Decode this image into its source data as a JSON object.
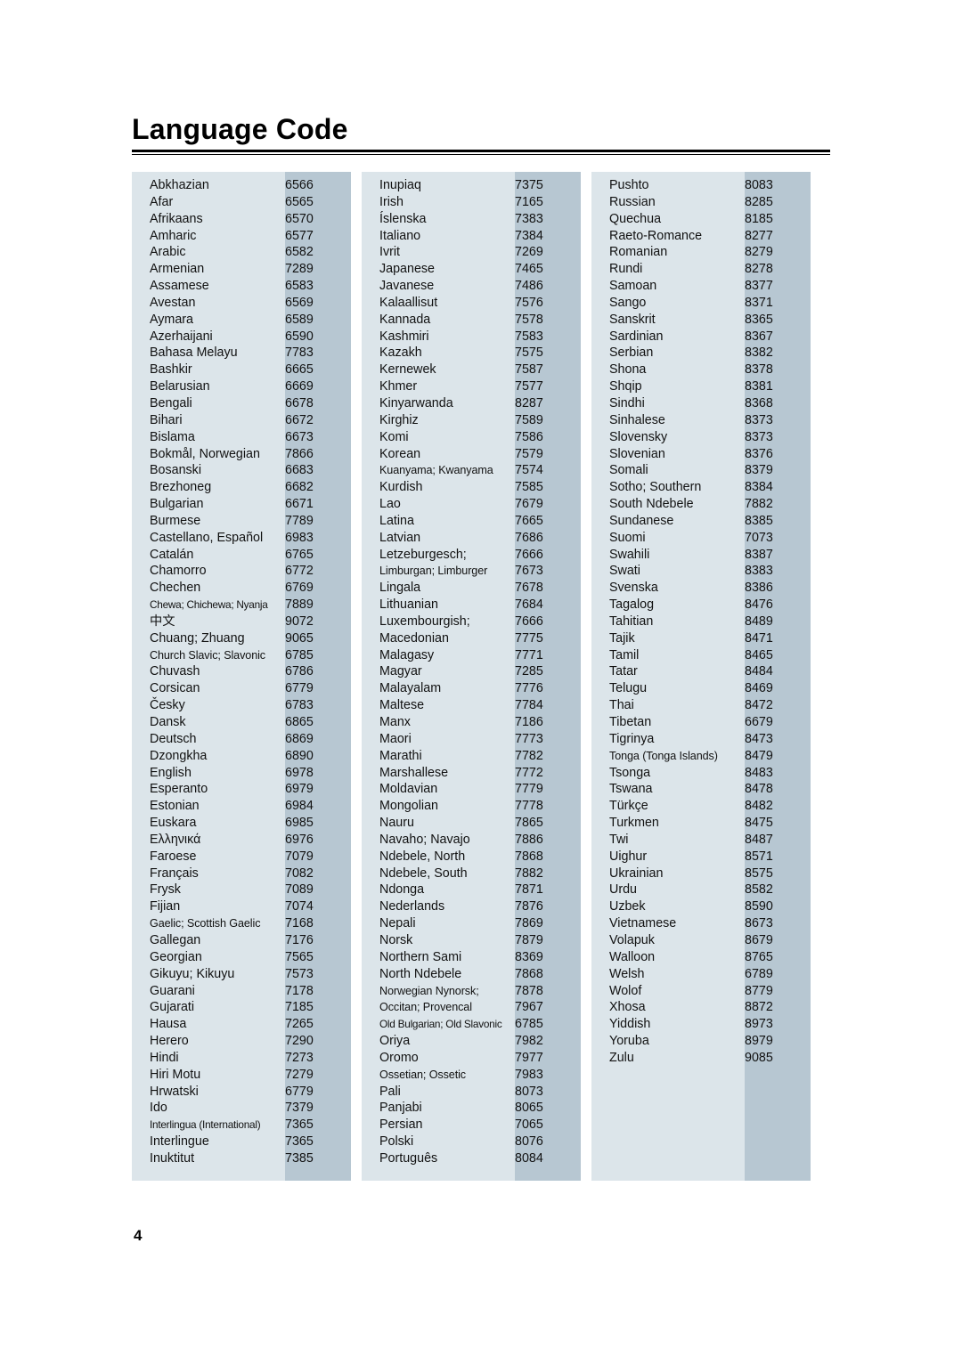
{
  "document": {
    "title": "Language Code",
    "page_number": "4"
  },
  "colors": {
    "row_light": "#dce5ea",
    "code_band": "#b7c7d2",
    "text": "#111111",
    "rule": "#000000"
  },
  "columns": [
    {
      "id": "column-1",
      "entries": [
        {
          "language": "Abkhazian",
          "code": "6566"
        },
        {
          "language": "Afar",
          "code": "6565"
        },
        {
          "language": "Afrikaans",
          "code": "6570"
        },
        {
          "language": "Amharic",
          "code": "6577"
        },
        {
          "language": "Arabic",
          "code": "6582"
        },
        {
          "language": "Armenian",
          "code": "7289"
        },
        {
          "language": "Assamese",
          "code": "6583"
        },
        {
          "language": "Avestan",
          "code": "6569"
        },
        {
          "language": "Aymara",
          "code": "6589"
        },
        {
          "language": "Azerhaijani",
          "code": "6590"
        },
        {
          "language": "Bahasa Melayu",
          "code": "7783"
        },
        {
          "language": "Bashkir",
          "code": "6665"
        },
        {
          "language": "Belarusian",
          "code": "6669"
        },
        {
          "language": "Bengali",
          "code": "6678"
        },
        {
          "language": "Bihari",
          "code": "6672"
        },
        {
          "language": "Bislama",
          "code": "6673"
        },
        {
          "language": "Bokmål, Norwegian",
          "code": "7866"
        },
        {
          "language": "Bosanski",
          "code": "6683"
        },
        {
          "language": "Brezhoneg",
          "code": "6682"
        },
        {
          "language": "Bulgarian",
          "code": "6671"
        },
        {
          "language": "Burmese",
          "code": "7789"
        },
        {
          "language": "Castellano, Español",
          "code": "6983"
        },
        {
          "language": "Catalán",
          "code": "6765"
        },
        {
          "language": "Chamorro",
          "code": "6772"
        },
        {
          "language": "Chechen",
          "code": "6769"
        },
        {
          "language": "Chewa; Chichewa; Nyanja",
          "code": "7889",
          "size": "xsm"
        },
        {
          "language": "中文",
          "code": "9072"
        },
        {
          "language": "Chuang; Zhuang",
          "code": "9065"
        },
        {
          "language": "Church Slavic; Slavonic",
          "code": "6785",
          "size": "sm"
        },
        {
          "language": "Chuvash",
          "code": "6786"
        },
        {
          "language": "Corsican",
          "code": "6779"
        },
        {
          "language": "Česky",
          "code": "6783"
        },
        {
          "language": "Dansk",
          "code": "6865"
        },
        {
          "language": "Deutsch",
          "code": "6869"
        },
        {
          "language": "Dzongkha",
          "code": "6890"
        },
        {
          "language": "English",
          "code": "6978"
        },
        {
          "language": "Esperanto",
          "code": "6979"
        },
        {
          "language": "Estonian",
          "code": "6984"
        },
        {
          "language": "Euskara",
          "code": "6985"
        },
        {
          "language": "Ελληνικά",
          "code": "6976"
        },
        {
          "language": "Faroese",
          "code": "7079"
        },
        {
          "language": "Français",
          "code": "7082"
        },
        {
          "language": "Frysk",
          "code": "7089"
        },
        {
          "language": "Fijian",
          "code": "7074"
        },
        {
          "language": "Gaelic; Scottish Gaelic",
          "code": "7168",
          "size": "sm"
        },
        {
          "language": "Gallegan",
          "code": "7176"
        },
        {
          "language": "Georgian",
          "code": "7565"
        },
        {
          "language": "Gikuyu; Kikuyu",
          "code": "7573"
        },
        {
          "language": "Guarani",
          "code": "7178"
        },
        {
          "language": "Gujarati",
          "code": "7185"
        },
        {
          "language": "Hausa",
          "code": "7265"
        },
        {
          "language": "Herero",
          "code": "7290"
        },
        {
          "language": "Hindi",
          "code": "7273"
        },
        {
          "language": "Hiri Motu",
          "code": "7279"
        },
        {
          "language": "Hrwatski",
          "code": "6779"
        },
        {
          "language": "Ido",
          "code": "7379"
        },
        {
          "language": "Interlingua (International)",
          "code": "7365",
          "size": "xsm"
        },
        {
          "language": "Interlingue",
          "code": "7365"
        },
        {
          "language": "Inuktitut",
          "code": "7385"
        }
      ]
    },
    {
      "id": "column-2",
      "entries": [
        {
          "language": "Inupiaq",
          "code": "7375"
        },
        {
          "language": "Irish",
          "code": "7165"
        },
        {
          "language": "Íslenska",
          "code": "7383"
        },
        {
          "language": "Italiano",
          "code": "7384"
        },
        {
          "language": "Ivrit",
          "code": "7269"
        },
        {
          "language": "Japanese",
          "code": "7465"
        },
        {
          "language": "Javanese",
          "code": "7486"
        },
        {
          "language": "Kalaallisut",
          "code": "7576"
        },
        {
          "language": "Kannada",
          "code": "7578"
        },
        {
          "language": "Kashmiri",
          "code": "7583"
        },
        {
          "language": "Kazakh",
          "code": "7575"
        },
        {
          "language": "Kernewek",
          "code": "7587"
        },
        {
          "language": "Khmer",
          "code": "7577"
        },
        {
          "language": "Kinyarwanda",
          "code": "8287"
        },
        {
          "language": "Kirghiz",
          "code": "7589"
        },
        {
          "language": "Komi",
          "code": "7586"
        },
        {
          "language": "Korean",
          "code": "7579"
        },
        {
          "language": "Kuanyama; Kwanyama",
          "code": "7574",
          "size": "sm"
        },
        {
          "language": "Kurdish",
          "code": "7585"
        },
        {
          "language": "Lao",
          "code": "7679"
        },
        {
          "language": "Latina",
          "code": "7665"
        },
        {
          "language": "Latvian",
          "code": "7686"
        },
        {
          "language": "Letzeburgesch;",
          "code": "7666"
        },
        {
          "language": "Limburgan; Limburger",
          "code": "7673",
          "size": "sm"
        },
        {
          "language": "Lingala",
          "code": "7678"
        },
        {
          "language": "Lithuanian",
          "code": "7684"
        },
        {
          "language": "Luxembourgish;",
          "code": "7666"
        },
        {
          "language": "Macedonian",
          "code": "7775"
        },
        {
          "language": "Malagasy",
          "code": "7771"
        },
        {
          "language": "Magyar",
          "code": "7285"
        },
        {
          "language": "Malayalam",
          "code": "7776"
        },
        {
          "language": "Maltese",
          "code": "7784"
        },
        {
          "language": "Manx",
          "code": "7186"
        },
        {
          "language": "Maori",
          "code": "7773"
        },
        {
          "language": "Marathi",
          "code": "7782"
        },
        {
          "language": "Marshallese",
          "code": "7772"
        },
        {
          "language": "Moldavian",
          "code": "7779"
        },
        {
          "language": "Mongolian",
          "code": "7778"
        },
        {
          "language": "Nauru",
          "code": "7865"
        },
        {
          "language": "Navaho; Navajo",
          "code": "7886"
        },
        {
          "language": "Ndebele, North",
          "code": "7868"
        },
        {
          "language": "Ndebele, South",
          "code": "7882"
        },
        {
          "language": "Ndonga",
          "code": "7871"
        },
        {
          "language": "Nederlands",
          "code": "7876"
        },
        {
          "language": "Nepali",
          "code": "7869"
        },
        {
          "language": "Norsk",
          "code": "7879"
        },
        {
          "language": "Northern Sami",
          "code": "8369"
        },
        {
          "language": "North Ndebele",
          "code": "7868"
        },
        {
          "language": "Norwegian Nynorsk;",
          "code": "7878",
          "size": "sm"
        },
        {
          "language": "Occitan; Provencal",
          "code": "7967",
          "size": "sm"
        },
        {
          "language": "Old Bulgarian; Old Slavonic",
          "code": "6785",
          "size": "xsm"
        },
        {
          "language": "Oriya",
          "code": "7982"
        },
        {
          "language": "Oromo",
          "code": "7977"
        },
        {
          "language": "Ossetian; Ossetic",
          "code": "7983",
          "size": "sm"
        },
        {
          "language": "Pali",
          "code": "8073"
        },
        {
          "language": "Panjabi",
          "code": "8065"
        },
        {
          "language": "Persian",
          "code": "7065"
        },
        {
          "language": "Polski",
          "code": "8076"
        },
        {
          "language": "Português",
          "code": "8084"
        }
      ]
    },
    {
      "id": "column-3",
      "entries": [
        {
          "language": "Pushto",
          "code": "8083"
        },
        {
          "language": "Russian",
          "code": "8285"
        },
        {
          "language": "Quechua",
          "code": "8185"
        },
        {
          "language": "Raeto-Romance",
          "code": "8277"
        },
        {
          "language": "Romanian",
          "code": "8279"
        },
        {
          "language": "Rundi",
          "code": "8278"
        },
        {
          "language": "Samoan",
          "code": "8377"
        },
        {
          "language": "Sango",
          "code": "8371"
        },
        {
          "language": "Sanskrit",
          "code": "8365"
        },
        {
          "language": "Sardinian",
          "code": "8367"
        },
        {
          "language": "Serbian",
          "code": "8382"
        },
        {
          "language": "Shona",
          "code": "8378"
        },
        {
          "language": "Shqip",
          "code": "8381"
        },
        {
          "language": "Sindhi",
          "code": "8368"
        },
        {
          "language": "Sinhalese",
          "code": "8373"
        },
        {
          "language": "Slovensky",
          "code": "8373"
        },
        {
          "language": "Slovenian",
          "code": "8376"
        },
        {
          "language": "Somali",
          "code": "8379"
        },
        {
          "language": "Sotho; Southern",
          "code": "8384"
        },
        {
          "language": "South Ndebele",
          "code": "7882"
        },
        {
          "language": "Sundanese",
          "code": "8385"
        },
        {
          "language": "Suomi",
          "code": "7073"
        },
        {
          "language": "Swahili",
          "code": "8387"
        },
        {
          "language": "Swati",
          "code": "8383"
        },
        {
          "language": "Svenska",
          "code": "8386"
        },
        {
          "language": "Tagalog",
          "code": "8476"
        },
        {
          "language": "Tahitian",
          "code": "8489"
        },
        {
          "language": "Tajik",
          "code": "8471"
        },
        {
          "language": "Tamil",
          "code": "8465"
        },
        {
          "language": "Tatar",
          "code": "8484"
        },
        {
          "language": "Telugu",
          "code": "8469"
        },
        {
          "language": "Thai",
          "code": "8472"
        },
        {
          "language": "Tibetan",
          "code": "6679"
        },
        {
          "language": "Tigrinya",
          "code": "8473"
        },
        {
          "language": "Tonga (Tonga Islands)",
          "code": "8479",
          "size": "sm"
        },
        {
          "language": "Tsonga",
          "code": "8483"
        },
        {
          "language": "Tswana",
          "code": "8478"
        },
        {
          "language": "Türkçe",
          "code": "8482"
        },
        {
          "language": "Turkmen",
          "code": "8475"
        },
        {
          "language": "Twi",
          "code": "8487"
        },
        {
          "language": "Uighur",
          "code": "8571"
        },
        {
          "language": "Ukrainian",
          "code": "8575"
        },
        {
          "language": "Urdu",
          "code": "8582"
        },
        {
          "language": "Uzbek",
          "code": "8590"
        },
        {
          "language": "Vietnamese",
          "code": "8673"
        },
        {
          "language": "Volapuk",
          "code": "8679"
        },
        {
          "language": "Walloon",
          "code": "8765"
        },
        {
          "language": "Welsh",
          "code": "6789"
        },
        {
          "language": "Wolof",
          "code": "8779"
        },
        {
          "language": "Xhosa",
          "code": "8872"
        },
        {
          "language": "Yiddish",
          "code": "8973"
        },
        {
          "language": "Yoruba",
          "code": "8979"
        },
        {
          "language": "Zulu",
          "code": "9085"
        }
      ]
    }
  ]
}
